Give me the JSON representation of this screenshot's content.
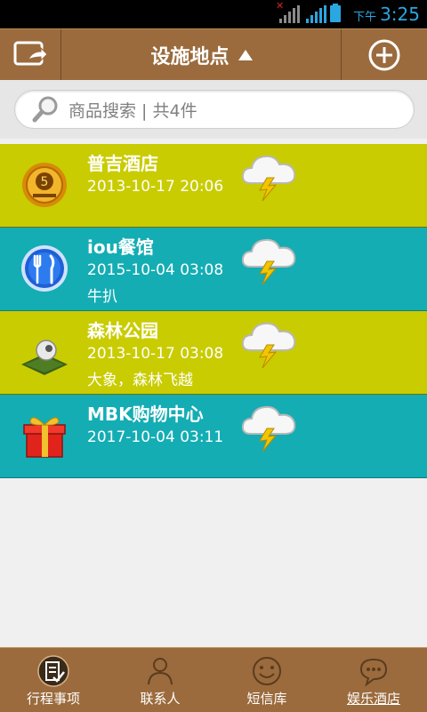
{
  "status_bar": {
    "ampm": "下午",
    "time": "3:25"
  },
  "header": {
    "title": "设施地点"
  },
  "search": {
    "placeholder": "商品搜索 | 共4件"
  },
  "items": [
    {
      "name": "普吉酒店",
      "date": "2013-10-17 20:06",
      "note": "",
      "icon": "vip-coin-icon",
      "color": "#c9cc00"
    },
    {
      "name": "iou餐馆",
      "date": "2015-10-04 03:08",
      "note": "牛扒",
      "icon": "cutlery-icon",
      "color": "#14adb4"
    },
    {
      "name": "森林公园",
      "date": "2013-10-17 03:08",
      "note": "大象，森林飞越",
      "icon": "golf-ball-icon",
      "color": "#c9cc00"
    },
    {
      "name": "MBK购物中心",
      "date": "2017-10-04 03:11",
      "note": "",
      "icon": "gift-box-icon",
      "color": "#14adb4"
    }
  ],
  "tabs": [
    {
      "label": "行程事项",
      "icon": "checklist-icon"
    },
    {
      "label": "联系人",
      "icon": "person-icon"
    },
    {
      "label": "短信库",
      "icon": "smiley-icon"
    },
    {
      "label": "娱乐酒店",
      "icon": "chat-bubble-icon",
      "active": true
    }
  ]
}
